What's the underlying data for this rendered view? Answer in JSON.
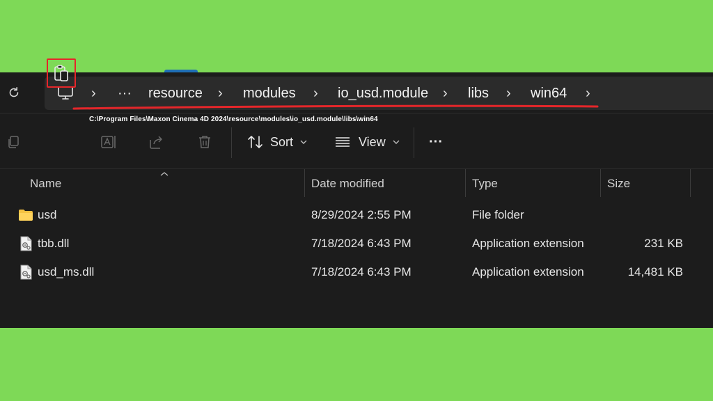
{
  "address_bar": {
    "crumbs": [
      "resource",
      "modules",
      "io_usd.module",
      "libs",
      "win64"
    ],
    "overflow_label": "···",
    "separator": "›"
  },
  "path_note": "C:\\Program Files\\Maxon Cinema 4D 2024\\resource\\modules\\io_usd.module\\libs\\win64",
  "command_bar": {
    "sort_label": "Sort",
    "view_label": "View",
    "more_label": "···"
  },
  "columns": {
    "name": "Name",
    "date": "Date modified",
    "type": "Type",
    "size": "Size"
  },
  "files": [
    {
      "name": "usd",
      "date": "8/29/2024 2:55 PM",
      "type": "File folder",
      "size": "",
      "icon": "folder-icon"
    },
    {
      "name": "tbb.dll",
      "date": "7/18/2024 6:43 PM",
      "type": "Application extension",
      "size": "231 KB",
      "icon": "dll-file-icon"
    },
    {
      "name": "usd_ms.dll",
      "date": "7/18/2024 6:43 PM",
      "type": "Application extension",
      "size": "14,481 KB",
      "icon": "dll-file-icon"
    }
  ],
  "colors": {
    "background": "#7ed957",
    "window": "#1c1c1c",
    "highlight": "#e5262a",
    "folder": "#f5c242"
  }
}
